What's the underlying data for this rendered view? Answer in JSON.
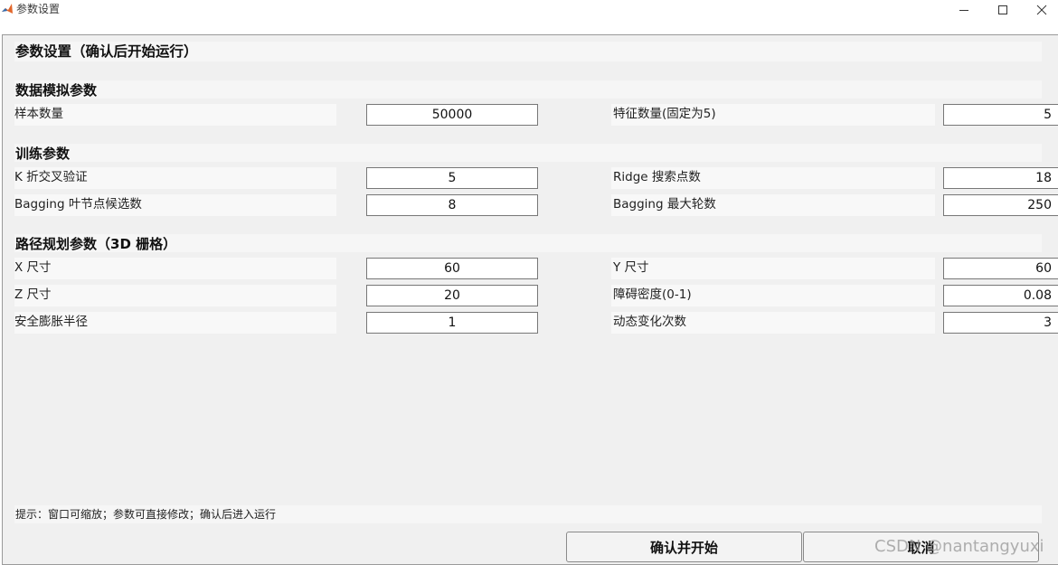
{
  "window": {
    "title": "参数设置",
    "controls": {
      "minimize": "—",
      "maximize": "☐",
      "close": "✕"
    }
  },
  "main": {
    "title": "参数设置（确认后开始运行）",
    "sections": {
      "data_sim": {
        "heading": "数据模拟参数",
        "sample_count": {
          "label": "样本数量",
          "value": "50000"
        },
        "feature_count": {
          "label": "特征数量(固定为5)",
          "value": "5"
        }
      },
      "training": {
        "heading": "训练参数",
        "k_fold": {
          "label": "K 折交叉验证",
          "value": "5"
        },
        "ridge_points": {
          "label": "Ridge 搜索点数",
          "value": "18"
        },
        "bagging_leaf": {
          "label": "Bagging 叶节点候选数",
          "value": "8"
        },
        "bagging_rounds": {
          "label": "Bagging 最大轮数",
          "value": "250"
        }
      },
      "path_planning": {
        "heading": "路径规划参数（3D 栅格）",
        "x_size": {
          "label": "X 尺寸",
          "value": "60"
        },
        "y_size": {
          "label": "Y 尺寸",
          "value": "60"
        },
        "z_size": {
          "label": "Z 尺寸",
          "value": "20"
        },
        "obstacle_density": {
          "label": "障碍密度(0-1)",
          "value": "0.08"
        },
        "safety_radius": {
          "label": "安全膨胀半径",
          "value": "1"
        },
        "dynamic_changes": {
          "label": "动态变化次数",
          "value": "3"
        }
      }
    },
    "hint": "提示：窗口可缩放；参数可直接修改；确认后进入运行",
    "buttons": {
      "confirm": "确认并开始",
      "cancel": "取消"
    }
  },
  "watermark": "CSDN @nantangyuxi",
  "colors": {
    "panel_bg": "#f0f0f0",
    "field_border": "#777777",
    "band_bg": "#f6f6f6"
  }
}
